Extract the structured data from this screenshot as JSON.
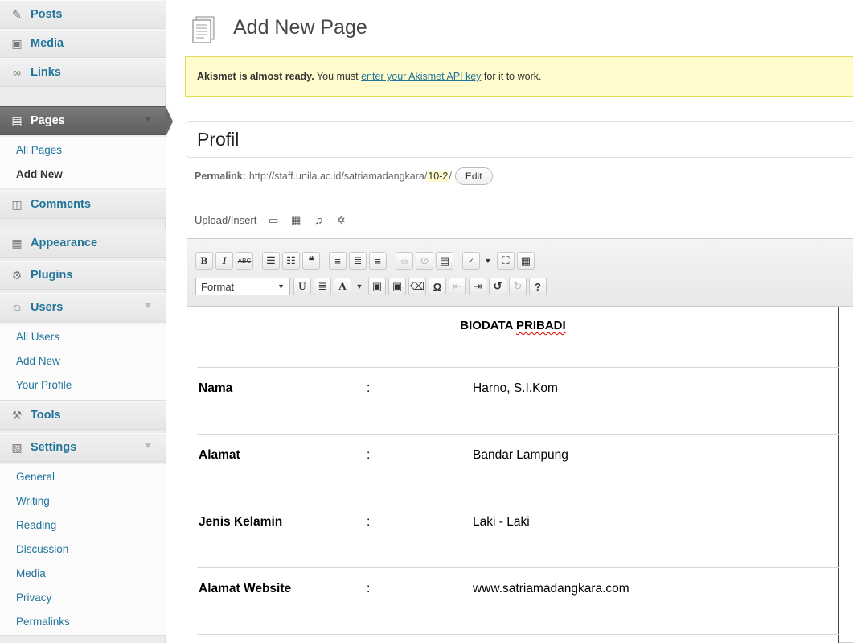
{
  "sidebar": {
    "items": [
      {
        "label": "Posts",
        "icon": "pin-icon"
      },
      {
        "label": "Media",
        "icon": "media-icon"
      },
      {
        "label": "Links",
        "icon": "link-icon"
      },
      {
        "label": "Pages",
        "icon": "pages-icon"
      },
      {
        "label": "Comments",
        "icon": "comment-icon"
      },
      {
        "label": "Appearance",
        "icon": "appearance-icon"
      },
      {
        "label": "Plugins",
        "icon": "plugin-icon"
      },
      {
        "label": "Users",
        "icon": "users-icon"
      },
      {
        "label": "Tools",
        "icon": "tools-icon"
      },
      {
        "label": "Settings",
        "icon": "settings-icon"
      }
    ],
    "pages_sub": [
      "All Pages",
      "Add New"
    ],
    "users_sub": [
      "All Users",
      "Add New",
      "Your Profile"
    ],
    "settings_sub": [
      "General",
      "Writing",
      "Reading",
      "Discussion",
      "Media",
      "Privacy",
      "Permalinks"
    ]
  },
  "header": {
    "title": "Add New Page"
  },
  "notice": {
    "bold": "Akismet is almost ready.",
    "text": "You must",
    "link": "enter your Akismet API key",
    "tail": "for it to work."
  },
  "editor": {
    "post_title": "Profil",
    "permalink_label": "Permalink:",
    "permalink_base": "http://staff.unila.ac.id/satriamadangkara/",
    "permalink_slug": "10-2",
    "permalink_trail": "/",
    "edit_label": "Edit",
    "upload_label": "Upload/Insert",
    "format_label": "Format"
  },
  "content": {
    "heading_a": "BIODATA ",
    "heading_b": "PRIBADI",
    "separator": ":",
    "rows": [
      {
        "label": "Nama",
        "value": "Harno, S.I.Kom"
      },
      {
        "label": "Alamat",
        "value": "Bandar Lampung"
      },
      {
        "label": "Jenis Kelamin",
        "value": "Laki - Laki"
      },
      {
        "label": "Alamat Website",
        "value": "www.satriamadangkara.com"
      }
    ]
  },
  "colors": {
    "link": "#21759b",
    "notice_bg": "#fffbcc",
    "active_menu": "#6a6a6a"
  }
}
